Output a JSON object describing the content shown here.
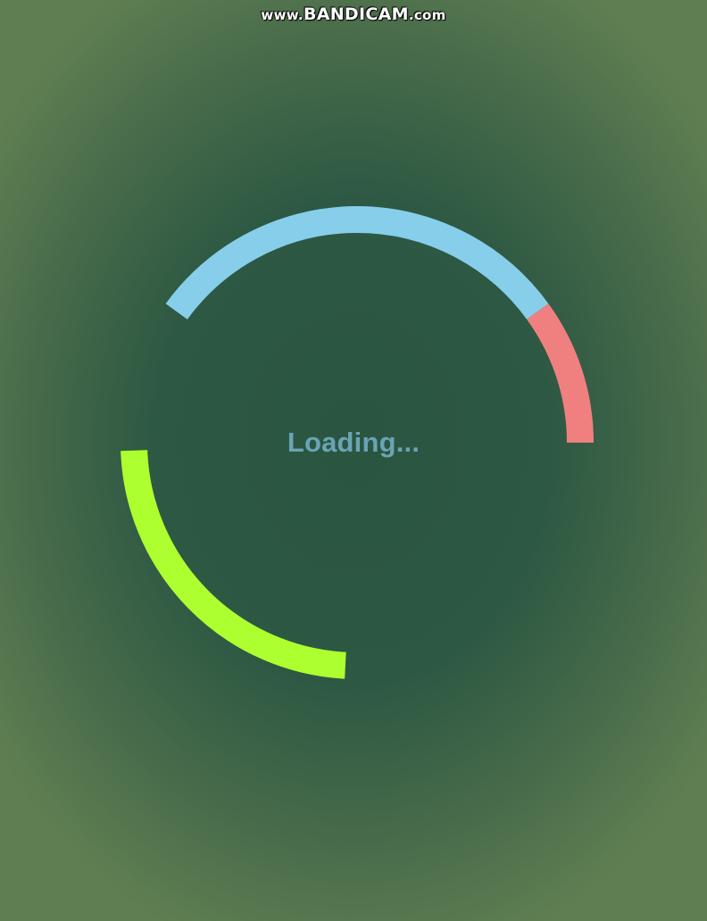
{
  "watermark": {
    "prefix": "www.",
    "brand": "BANDICAM",
    "suffix": ".com"
  },
  "loader": {
    "text": "Loading...",
    "rings": [
      {
        "name": "blue-arc",
        "color": "#87ceeb",
        "start_deg": -52,
        "end_deg": 36
      },
      {
        "name": "red-arc",
        "color": "#f08080",
        "start_deg": 36,
        "end_deg": 90
      },
      {
        "name": "green-arc",
        "color": "#adff2f",
        "start_deg": 182,
        "end_deg": 275
      }
    ]
  },
  "colors": {
    "background_center": "#2a5541",
    "background_edge": "#5f7f52",
    "loading_text": "#6aa4b4"
  }
}
